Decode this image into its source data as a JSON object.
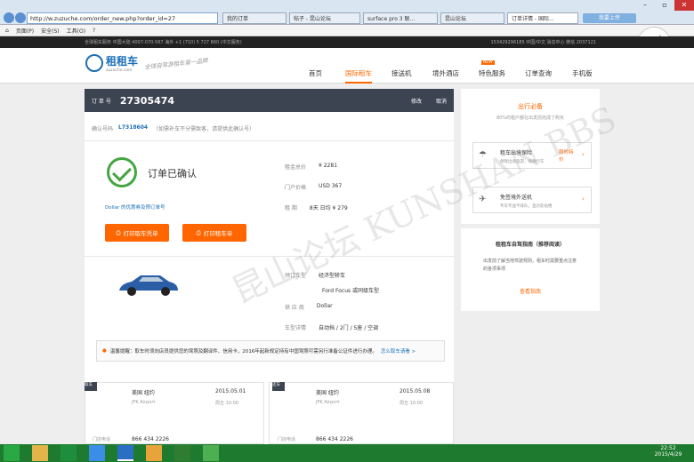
{
  "browser": {
    "url": "http://w.zuzuche.com/order_new.php?order_id=27",
    "tabs": [
      "我的订单",
      "帖子 - 昆山论坛",
      "surface pro 3 联...",
      "昆山论坛",
      "订单详情 - 国际..."
    ],
    "menu": [
      "页面(P)",
      "安全(S)",
      "工具(O)"
    ],
    "float_btn": "我要上传"
  },
  "site": {
    "topstrip_left": "全球租车服务  中国大陆 4007-070-567   海外 +1 (710) 5 727 860 (中文服务)",
    "topstrip_right": "153429296185   中国/中文   消息中心  微信 2037121",
    "logo": "租租车",
    "logo_sub": "zuzuche.com",
    "slogan": "全球自驾游租车第一品牌",
    "nav": [
      "首页",
      "国际租车",
      "接送机",
      "境外酒店",
      "特色服务",
      "订单查询",
      "手机版"
    ],
    "nav_badge": "NEW"
  },
  "order": {
    "label": "订 单 号",
    "number": "27305474",
    "actions": [
      "修改",
      "取消"
    ],
    "confirm_label": "确认号码",
    "confirm_no": "L7318604",
    "confirm_note": "（如需补车不分需致客，请提供此确认号）",
    "status": "订单已确认",
    "rental_lines": [
      {
        "label": "租金总价",
        "value": "¥ 2281"
      },
      {
        "label": "门户价格",
        "value": "USD 367"
      },
      {
        "label": "租    期",
        "value": "8天   日均 ¥ 279"
      }
    ],
    "dollar_note": "Dollar 的优惠券及预订单号",
    "btn_print_voucher": "打印取车凭单",
    "btn_print_car": "打印租车单",
    "car_lines": [
      {
        "label": "预订车型",
        "value": "经济型轿车"
      },
      {
        "label": "",
        "value": "Ford Focus 或同级车型"
      },
      {
        "label": "供 应 商",
        "value": "Dollar"
      },
      {
        "label": "车型详情",
        "value": "自动挡 / 2门 / 5座 / 空调"
      }
    ],
    "notice": "温馨提醒：取车时须向店员提供您的驾照及翻译件、信用卡，2016年起新规定持有中国驾照可需另行准备公证件进行办理。",
    "notice_link": "怎么取车请看 >",
    "pickup": {
      "tag": "取车",
      "city": "美国  纽约",
      "date": "2015.05.01",
      "place": "JFK Airport",
      "time": "周五 10:00",
      "phone": "866 434 2226",
      "phone_label": "门店电话"
    },
    "dropoff": {
      "tag": "还车",
      "city": "美国  纽约",
      "date": "2015.05.08",
      "place": "JFK Airport",
      "time": "周五 10:00",
      "phone": "866 434 2226",
      "phone_label": "门店电话"
    }
  },
  "sidebar": {
    "title": "出行必备",
    "sub": "80%的租户都在出发前完成了购买",
    "item1_title": "租车出境保险",
    "item1_sub": "保障出境旅游，保障行车",
    "item1_tag": "限时特价",
    "item2_title": "免签境外送机",
    "item2_sub": "专车专送不排队，直达航站楼",
    "panel_title": "租租车自驾指南（推荐阅读）",
    "panel_text": "出发前了解当地驾驶规则，租车时需要重点注意的各项事项",
    "panel_link": "查看指南"
  },
  "watermark": "昆山论坛 KUNSHAN BBS",
  "taskbar": {
    "time": "22:52",
    "date": "2015/4/29"
  }
}
